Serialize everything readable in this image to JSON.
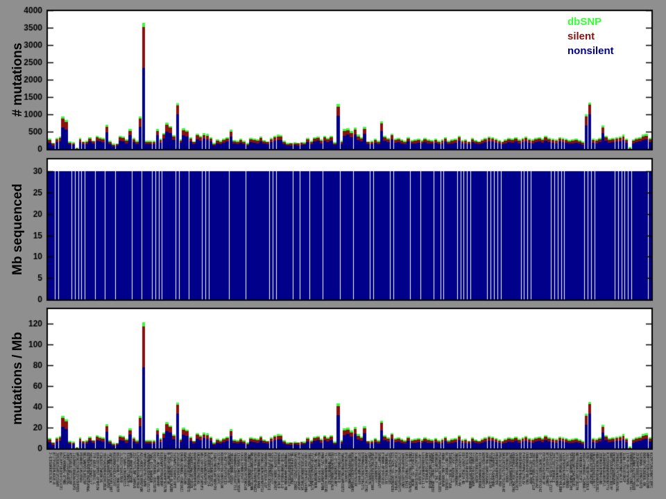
{
  "figure": {
    "background_color": "#8F8F8F",
    "panel_background": "#FFFFFF",
    "axis_color": "#000000"
  },
  "legend": {
    "items": [
      {
        "label": "dbSNP",
        "color": "#33FF33"
      },
      {
        "label": "silent",
        "color": "#8B1010"
      },
      {
        "label": "nonsilent",
        "color": "#00008B"
      }
    ]
  },
  "chart_data": [
    {
      "type": "bar",
      "stacked": true,
      "title": "",
      "ylabel": "# mutations",
      "xlabel": "",
      "ylim": [
        0,
        4000
      ],
      "yticks": [
        0,
        500,
        1000,
        1500,
        2000,
        2500,
        3000,
        3500,
        4000
      ],
      "grid": false,
      "legend_position": "top-right",
      "series_order_bottom_to_top": [
        "nonsilent",
        "silent",
        "dbSNP"
      ],
      "values_from": "samples.bars"
    },
    {
      "type": "bar",
      "stacked": false,
      "title": "",
      "ylabel": "Mb sequenced",
      "xlabel": "",
      "ylim": [
        0,
        33
      ],
      "yticks": [
        0,
        5,
        10,
        15,
        20,
        25,
        30
      ],
      "grid": false,
      "constant_value": 30
    },
    {
      "type": "bar",
      "stacked": true,
      "title": "",
      "ylabel": "mutations / Mb",
      "xlabel": "",
      "ylim": [
        0,
        135
      ],
      "yticks": [
        0,
        20,
        40,
        60,
        80,
        100,
        120
      ],
      "grid": false,
      "derived": "samples.bars divided by samples.mb_sequenced_each"
    }
  ],
  "x_axis": {
    "tick_labels_legible": false,
    "orientation": "vertical",
    "sample_count": 180
  },
  "samples": {
    "mb_sequenced_each": 30,
    "separator_after": [
      1,
      2,
      6,
      7,
      8,
      9,
      10,
      13,
      16,
      19,
      24,
      27,
      30,
      31,
      32,
      33,
      37,
      38,
      41,
      45,
      46,
      47,
      53,
      58,
      65,
      66,
      67,
      72,
      74,
      77,
      81,
      86,
      90,
      95,
      96,
      101,
      102,
      107,
      110,
      114,
      116,
      117,
      121,
      122,
      123,
      124,
      125,
      130,
      131,
      132,
      133,
      134,
      140,
      141,
      142,
      143,
      149,
      150,
      151,
      152,
      153,
      159,
      160,
      161,
      162,
      168,
      169,
      170,
      171,
      172,
      173,
      178
    ],
    "bars": [
      [
        180,
        80,
        40
      ],
      [
        110,
        50,
        30
      ],
      [
        200,
        90,
        40
      ],
      [
        220,
        100,
        40
      ],
      [
        630,
        250,
        70
      ],
      [
        560,
        220,
        60
      ],
      [
        140,
        50,
        30
      ],
      [
        120,
        50,
        30
      ],
      [
        10,
        10,
        20
      ],
      [
        200,
        90,
        40
      ],
      [
        140,
        60,
        30
      ],
      [
        150,
        60,
        30
      ],
      [
        220,
        80,
        40
      ],
      [
        160,
        60,
        30
      ],
      [
        250,
        90,
        40
      ],
      [
        220,
        90,
        40
      ],
      [
        210,
        80,
        40
      ],
      [
        480,
        160,
        60
      ],
      [
        150,
        60,
        30
      ],
      [
        90,
        40,
        30
      ],
      [
        100,
        40,
        30
      ],
      [
        250,
        100,
        40
      ],
      [
        230,
        90,
        40
      ],
      [
        170,
        70,
        40
      ],
      [
        400,
        130,
        50
      ],
      [
        210,
        80,
        40
      ],
      [
        150,
        60,
        40
      ],
      [
        650,
        230,
        70
      ],
      [
        2340,
        1180,
        130
      ],
      [
        150,
        60,
        30
      ],
      [
        150,
        60,
        40
      ],
      [
        150,
        60,
        40
      ],
      [
        400,
        130,
        50
      ],
      [
        190,
        70,
        40
      ],
      [
        300,
        120,
        50
      ],
      [
        500,
        200,
        60
      ],
      [
        470,
        150,
        50
      ],
      [
        270,
        100,
        40
      ],
      [
        1000,
        270,
        60
      ],
      [
        180,
        70,
        40
      ],
      [
        410,
        140,
        50
      ],
      [
        370,
        130,
        50
      ],
      [
        220,
        90,
        40
      ],
      [
        140,
        60,
        30
      ],
      [
        290,
        110,
        50
      ],
      [
        250,
        90,
        40
      ],
      [
        300,
        110,
        50
      ],
      [
        280,
        110,
        50
      ],
      [
        220,
        90,
        40
      ],
      [
        100,
        50,
        30
      ],
      [
        170,
        70,
        40
      ],
      [
        150,
        60,
        40
      ],
      [
        190,
        70,
        40
      ],
      [
        220,
        80,
        40
      ],
      [
        370,
        140,
        50
      ],
      [
        160,
        60,
        40
      ],
      [
        150,
        60,
        40
      ],
      [
        190,
        70,
        40
      ],
      [
        150,
        60,
        40
      ],
      [
        100,
        50,
        30
      ],
      [
        210,
        80,
        40
      ],
      [
        190,
        70,
        40
      ],
      [
        170,
        70,
        40
      ],
      [
        230,
        90,
        40
      ],
      [
        160,
        60,
        40
      ],
      [
        140,
        60,
        30
      ],
      [
        200,
        80,
        40
      ],
      [
        250,
        90,
        40
      ],
      [
        270,
        100,
        50
      ],
      [
        260,
        100,
        40
      ],
      [
        150,
        60,
        40
      ],
      [
        100,
        50,
        30
      ],
      [
        110,
        50,
        30
      ],
      [
        120,
        50,
        30
      ],
      [
        110,
        50,
        30
      ],
      [
        130,
        50,
        30
      ],
      [
        120,
        50,
        30
      ],
      [
        200,
        80,
        40
      ],
      [
        150,
        60,
        40
      ],
      [
        220,
        90,
        40
      ],
      [
        240,
        90,
        40
      ],
      [
        170,
        70,
        40
      ],
      [
        250,
        100,
        40
      ],
      [
        210,
        80,
        40
      ],
      [
        250,
        90,
        40
      ],
      [
        120,
        50,
        30
      ],
      [
        960,
        260,
        80
      ],
      [
        150,
        60,
        40
      ],
      [
        390,
        140,
        50
      ],
      [
        420,
        130,
        50
      ],
      [
        350,
        120,
        50
      ],
      [
        420,
        150,
        50
      ],
      [
        270,
        100,
        50
      ],
      [
        220,
        90,
        40
      ],
      [
        440,
        150,
        50
      ],
      [
        140,
        60,
        30
      ],
      [
        150,
        60,
        40
      ],
      [
        190,
        70,
        40
      ],
      [
        150,
        60,
        40
      ],
      [
        530,
        210,
        60
      ],
      [
        250,
        90,
        40
      ],
      [
        200,
        80,
        40
      ],
      [
        290,
        110,
        50
      ],
      [
        190,
        70,
        40
      ],
      [
        210,
        80,
        40
      ],
      [
        170,
        70,
        40
      ],
      [
        150,
        60,
        40
      ],
      [
        220,
        80,
        40
      ],
      [
        160,
        60,
        40
      ],
      [
        170,
        70,
        40
      ],
      [
        190,
        70,
        40
      ],
      [
        160,
        60,
        40
      ],
      [
        200,
        80,
        40
      ],
      [
        170,
        70,
        40
      ],
      [
        160,
        60,
        40
      ],
      [
        190,
        70,
        40
      ],
      [
        150,
        60,
        30
      ],
      [
        170,
        70,
        40
      ],
      [
        220,
        80,
        40
      ],
      [
        150,
        60,
        40
      ],
      [
        170,
        70,
        40
      ],
      [
        190,
        70,
        40
      ],
      [
        250,
        90,
        40
      ],
      [
        160,
        60,
        40
      ],
      [
        170,
        70,
        40
      ],
      [
        140,
        60,
        30
      ],
      [
        200,
        80,
        40
      ],
      [
        160,
        60,
        40
      ],
      [
        140,
        60,
        30
      ],
      [
        170,
        70,
        40
      ],
      [
        200,
        80,
        40
      ],
      [
        230,
        90,
        40
      ],
      [
        220,
        80,
        40
      ],
      [
        190,
        70,
        40
      ],
      [
        160,
        60,
        40
      ],
      [
        140,
        60,
        30
      ],
      [
        170,
        70,
        40
      ],
      [
        200,
        80,
        40
      ],
      [
        190,
        70,
        40
      ],
      [
        220,
        90,
        40
      ],
      [
        170,
        70,
        40
      ],
      [
        210,
        80,
        40
      ],
      [
        230,
        90,
        40
      ],
      [
        190,
        70,
        40
      ],
      [
        170,
        70,
        40
      ],
      [
        200,
        80,
        40
      ],
      [
        220,
        80,
        40
      ],
      [
        190,
        70,
        40
      ],
      [
        250,
        90,
        40
      ],
      [
        200,
        80,
        40
      ],
      [
        190,
        70,
        40
      ],
      [
        170,
        70,
        40
      ],
      [
        220,
        80,
        40
      ],
      [
        200,
        80,
        40
      ],
      [
        190,
        70,
        40
      ],
      [
        160,
        60,
        40
      ],
      [
        170,
        70,
        40
      ],
      [
        190,
        70,
        40
      ],
      [
        160,
        60,
        40
      ],
      [
        130,
        50,
        40
      ],
      [
        680,
        260,
        60
      ],
      [
        1010,
        270,
        70
      ],
      [
        190,
        70,
        40
      ],
      [
        170,
        70,
        40
      ],
      [
        200,
        80,
        40
      ],
      [
        460,
        160,
        60
      ],
      [
        250,
        90,
        40
      ],
      [
        190,
        70,
        40
      ],
      [
        200,
        80,
        40
      ],
      [
        220,
        80,
        40
      ],
      [
        230,
        90,
        40
      ],
      [
        270,
        100,
        50
      ],
      [
        190,
        70,
        40
      ],
      [
        15,
        15,
        30
      ],
      [
        170,
        70,
        40
      ],
      [
        200,
        80,
        40
      ],
      [
        220,
        80,
        40
      ],
      [
        270,
        100,
        50
      ],
      [
        280,
        110,
        50
      ],
      [
        210,
        80,
        40
      ]
    ]
  }
}
